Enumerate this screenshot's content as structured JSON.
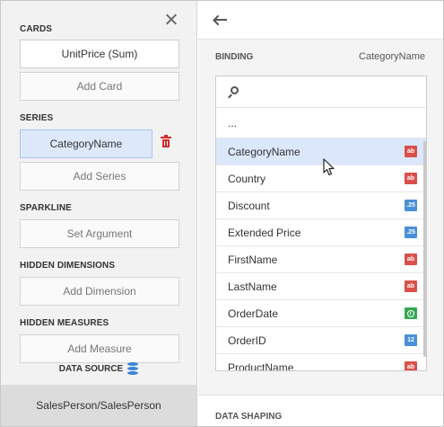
{
  "left_panel": {
    "sections": {
      "cards": "CARDS",
      "series": "SERIES",
      "sparkline": "SPARKLINE",
      "hidden_dimensions": "HIDDEN DIMENSIONS",
      "hidden_measures": "HIDDEN MEASURES"
    },
    "buttons": {
      "card_value": "UnitPrice (Sum)",
      "add_card": "Add Card",
      "series_value": "CategoryName",
      "add_series": "Add Series",
      "set_argument": "Set Argument",
      "add_dimension": "Add Dimension",
      "add_measure": "Add Measure"
    },
    "data_source_label": "DATA SOURCE",
    "footer": "SalesPerson/SalesPerson",
    "icons": {
      "close": "close-icon",
      "delete": "trash-icon",
      "data_source": "database-icon"
    }
  },
  "right_panel": {
    "binding_label": "BINDING",
    "binding_value": "CategoryName",
    "search": {
      "value": "",
      "placeholder": ""
    },
    "ellipsis": "...",
    "fields": [
      {
        "name": "CategoryName",
        "type_badge": "ab",
        "type": "string",
        "selected": true
      },
      {
        "name": "Country",
        "type_badge": "ab",
        "type": "string",
        "selected": false
      },
      {
        "name": "Discount",
        "type_badge": ".25",
        "type": "number",
        "selected": false
      },
      {
        "name": "Extended Price",
        "type_badge": ".25",
        "type": "number",
        "selected": false
      },
      {
        "name": "FirstName",
        "type_badge": "ab",
        "type": "string",
        "selected": false
      },
      {
        "name": "LastName",
        "type_badge": "ab",
        "type": "string",
        "selected": false
      },
      {
        "name": "OrderDate",
        "type_badge": "",
        "type": "date",
        "selected": false
      },
      {
        "name": "OrderID",
        "type_badge": "12",
        "type": "integer",
        "selected": false
      },
      {
        "name": "ProductName",
        "type_badge": "ab",
        "type": "string",
        "selected": false
      }
    ],
    "footer_label": "DATA SHAPING"
  },
  "colors": {
    "selected_bg": "#dbe7fb",
    "string_badge": "#d9504a",
    "number_badge": "#4a8fd9",
    "date_badge": "#35a852",
    "delete": "#cf2b2b",
    "database": "#3b83d6"
  }
}
